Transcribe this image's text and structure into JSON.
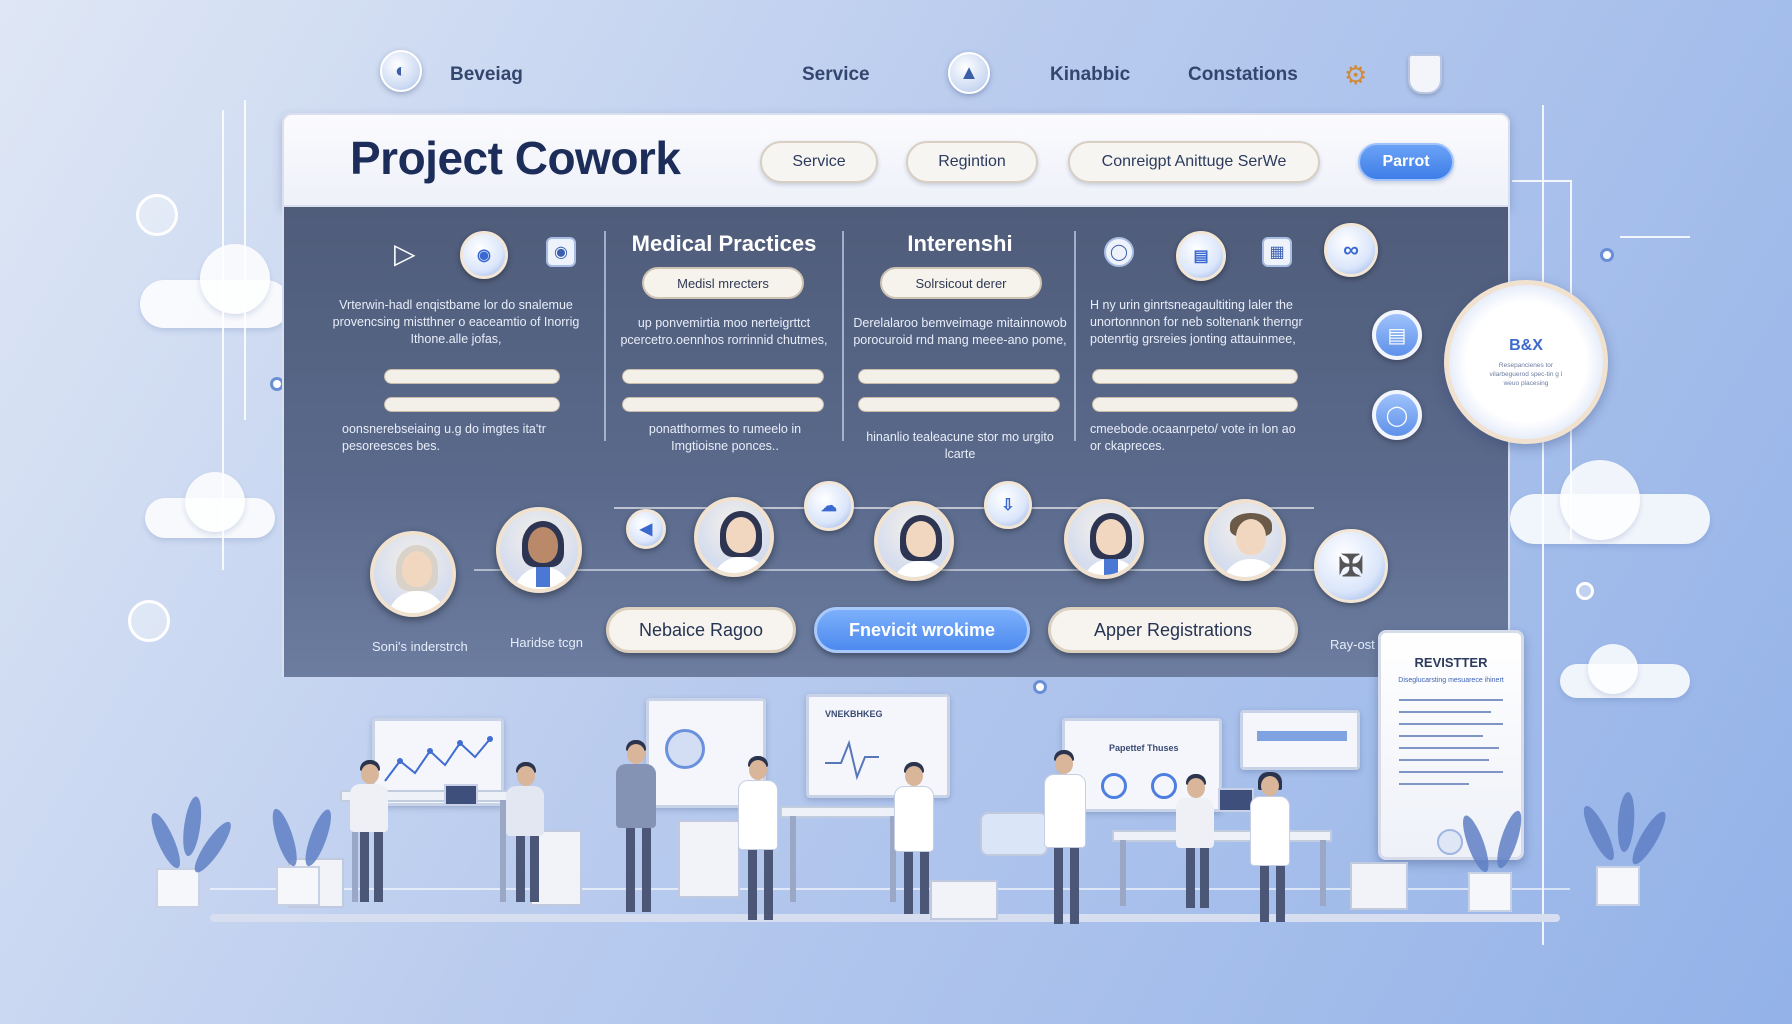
{
  "top_nav": {
    "items": [
      "Beveiag",
      "Service",
      "Kinabbic",
      "Constations"
    ]
  },
  "header": {
    "title": "Project Cowork",
    "buttons": [
      "Service",
      "Regintion",
      "Conreigpt Anittuge SerWe",
      "Parrot"
    ]
  },
  "columns": [
    {
      "title": "",
      "tag": "",
      "para1": "Vrterwin-hadl enqistbame lor do snalemue provencsing mistthner o eaceamtio of Inorrig Ithone.alle jofas,",
      "para2": "oonsnerebseiaing u.g do imgtes ita'tr pesoreesces bes."
    },
    {
      "title": "Medical Practices",
      "tag": "Medisl mrecters",
      "para1": "up ponvemirtia moo nerteigrttct pcercetro.oennhos rorrinnid chutmes,",
      "para2": "ponatthormes to rumeelo in Imgtioisne ponces.."
    },
    {
      "title": "Interenshi",
      "tag": "Solrsicout derer",
      "para1": "Derelalaroo bemveimage mitainnowob porocuroid rnd mang meee-ano pome,",
      "para2": "hinanlio tealeacune stor mo urgito lcarte"
    },
    {
      "title": "",
      "tag": "",
      "para1": "H ny urin ginrtsneagaultiting laler the unortonnnon for neb soltenank therngr potenrtig grsreies jonting attauinmee,",
      "para2": "cmeebode.ocaanrpeto/ vote in lon ao or ckapreces."
    }
  ],
  "team": {
    "captions": [
      "Soni's inderstrch",
      "Haridse tcgn",
      "Ray-ost"
    ],
    "buttons": [
      "Nebaice Ragoo",
      "Fnevicit wrokime",
      "Apper Registrations"
    ]
  },
  "badge": {
    "title": "B&X",
    "subtitle": "Resepancienes tor vilarbeguerod spec-tin g I weuo placesing"
  },
  "register": {
    "title": "REVISTTER",
    "subtitle": "Diseglucarsting mesuarece ihinert"
  },
  "scene": {
    "board_labels": [
      "VNEKBHKEG",
      "Papettef Thuses"
    ]
  },
  "colors": {
    "accent": "#4d8aef",
    "panel": "#56658a",
    "title": "#1c2d5a"
  },
  "icons": [
    "chat-icon",
    "camera-icon",
    "link-icon",
    "clipboard-icon",
    "circle-icon",
    "download-icon",
    "cloud-icon",
    "ribbon-icon",
    "gear-icon",
    "shield-icon"
  ]
}
